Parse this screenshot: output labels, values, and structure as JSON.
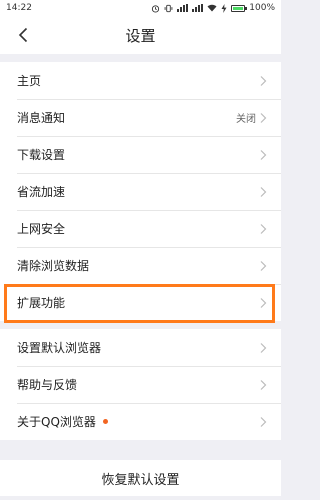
{
  "status": {
    "time": "14:22",
    "battery_text": "100%",
    "battery_level": 1.0
  },
  "header": {
    "title": "设置"
  },
  "groups": [
    {
      "items": [
        {
          "label": "主页"
        },
        {
          "label": "消息通知",
          "value": "关闭"
        },
        {
          "label": "下载设置"
        },
        {
          "label": "省流加速"
        },
        {
          "label": "上网安全"
        },
        {
          "label": "清除浏览数据"
        },
        {
          "label": "扩展功能"
        }
      ]
    },
    {
      "items": [
        {
          "label": "设置默认浏览器"
        },
        {
          "label": "帮助与反馈"
        },
        {
          "label": "关于QQ浏览器"
        }
      ]
    }
  ],
  "restore": {
    "label": "恢复默认设置"
  },
  "colors": {
    "highlight": "#ff7a1a",
    "badge": "#f26522",
    "battery_fill": "#4cd964"
  },
  "icons": {
    "back": "chevron-left-icon",
    "row_arrow": "chevron-right-icon"
  }
}
